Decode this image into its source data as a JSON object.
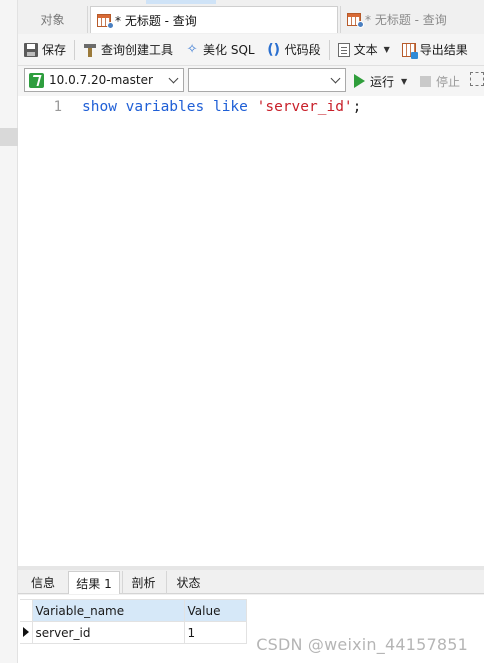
{
  "tabs": {
    "objects_label": "对象",
    "active_label": "* 无标题 - 查询",
    "inactive_label": "* 无标题 - 查询"
  },
  "toolbar": {
    "save": "保存",
    "query_builder": "查询创建工具",
    "beautify": "美化 SQL",
    "snippet": "代码段",
    "text": "文本",
    "export": "导出结果"
  },
  "connection": {
    "selected": "10.0.7.20-master",
    "database": ""
  },
  "run": {
    "run_label": "运行",
    "stop_label": "停止"
  },
  "editor": {
    "line_number": "1",
    "code_tokens": [
      "show",
      "variables",
      "like",
      "'server_id'",
      ";"
    ]
  },
  "result_tabs": [
    "信息",
    "结果 1",
    "剖析",
    "状态"
  ],
  "grid": {
    "columns": [
      "Variable_name",
      "Value"
    ],
    "rows": [
      [
        "server_id",
        "1"
      ]
    ]
  },
  "watermark": "CSDN @weixin_44157851",
  "colors": {
    "keyword": "#1f5fd6",
    "string": "#c8202a",
    "header_bg": "#d6e8f8",
    "run_green": "#2f9e3b"
  }
}
